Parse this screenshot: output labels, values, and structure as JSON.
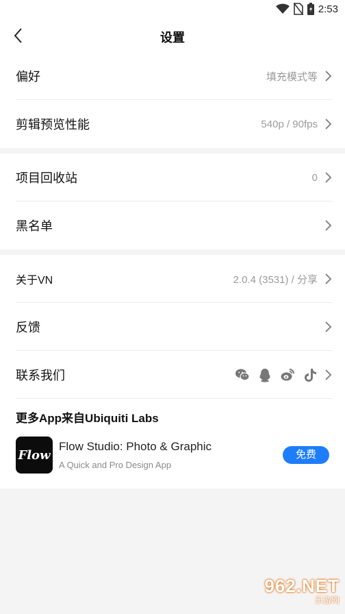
{
  "status_bar": {
    "time": "2:53"
  },
  "nav": {
    "title": "设置"
  },
  "groups": [
    {
      "rows": [
        {
          "label": "偏好",
          "value": "填充模式等"
        },
        {
          "label": "剪辑预览性能",
          "value": "540p / 90fps"
        }
      ]
    },
    {
      "rows": [
        {
          "label": "项目回收站",
          "value": "0"
        },
        {
          "label": "黑名单",
          "value": ""
        }
      ]
    },
    {
      "rows": [
        {
          "label": "关于VN",
          "value": "2.0.4 (3531) / 分享"
        },
        {
          "label": "反馈",
          "value": ""
        },
        {
          "label": "联系我们",
          "value": "",
          "icons": [
            "wechat-icon",
            "qq-icon",
            "weibo-icon",
            "tiktok-icon"
          ]
        }
      ]
    }
  ],
  "more_apps": {
    "heading": "更多App来自Ubiquiti Labs",
    "app": {
      "icon_text": "Flow",
      "name": "Flow Studio: Photo & Graphic",
      "description": "A Quick and Pro Design App",
      "button": "免费"
    }
  },
  "watermark": {
    "top": "962.NET",
    "bottom": "乐游网"
  },
  "colors": {
    "accent": "#1e7dfa",
    "background": "#f4f4f4",
    "muted_text": "#9a9a9a"
  }
}
